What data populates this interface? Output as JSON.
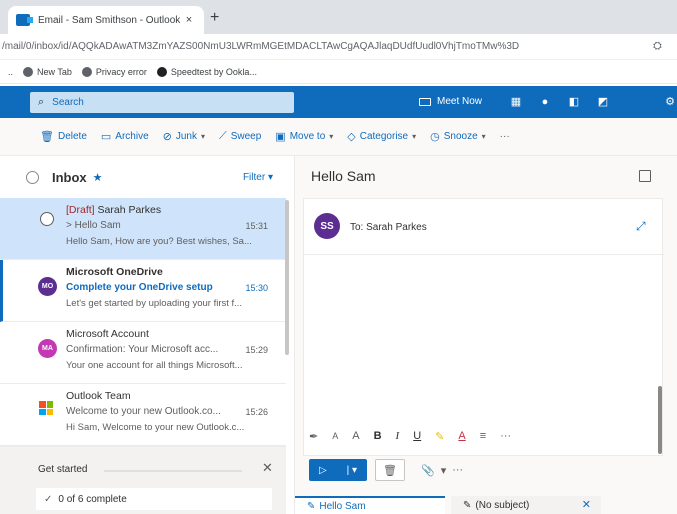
{
  "browser": {
    "tab_title": "Email - Sam Smithson - Outlook",
    "tab_close": "×",
    "new_tab": "+",
    "url": "/mail/0/inbox/id/AQQkADAwATM3ZmYAZS00NmU3LWRmMGEtMDACLTAwCgAQAJlaqDUdfUudl0VhjTmoTMw%3D",
    "bookmarks": [
      {
        "label": "New Tab",
        "icon": "globe-icon"
      },
      {
        "label": "Privacy error",
        "icon": "globe-icon"
      },
      {
        "label": "Speedtest by Ookla...",
        "icon": "speedtest-icon"
      }
    ]
  },
  "header": {
    "search_placeholder": "Search",
    "meet_now": "Meet Now",
    "brand_color": "#0f6cbd"
  },
  "commands": [
    {
      "label": "Delete",
      "icon": "trash-icon"
    },
    {
      "label": "Archive",
      "icon": "archive-icon"
    },
    {
      "label": "Junk",
      "icon": "block-icon"
    },
    {
      "label": "Sweep",
      "icon": "broom-icon"
    },
    {
      "label": "Move to",
      "icon": "folder-move-icon"
    },
    {
      "label": "Categorise",
      "icon": "tag-icon"
    },
    {
      "label": "Snooze",
      "icon": "clock-icon"
    },
    {
      "label": "···",
      "icon": "more-icon"
    }
  ],
  "inbox": {
    "title": "Inbox",
    "filter": "Filter",
    "messages": [
      {
        "draft_tag": "[Draft]",
        "sender": "Sarah Parkes",
        "subject": "> Hello Sam",
        "time": "15:31",
        "preview": "Hello Sam, How are you? Best wishes, Sa..."
      },
      {
        "initials": "MO",
        "sender": "Microsoft OneDrive",
        "subject": "Complete your OneDrive setup",
        "time": "15:30",
        "preview": "Let's get started by uploading your first f..."
      },
      {
        "initials": "MA",
        "sender": "Microsoft Account",
        "subject": "Confirmation: Your Microsoft acc...",
        "time": "15:29",
        "preview": "Your one account for all things Microsoft..."
      },
      {
        "sender": "Outlook Team",
        "subject": "Welcome to your new Outlook.co...",
        "time": "15:26",
        "preview": "Hi Sam, Welcome to your new Outlook.c..."
      }
    ]
  },
  "get_started": {
    "title": "Get started",
    "progress_text": "0 of 6 complete",
    "progress_fraction": 0
  },
  "reading": {
    "title": "Hello Sam",
    "avatar_initials": "SS",
    "to": "To: Sarah Parkes"
  },
  "format_bar": {
    "font_size_a": "A",
    "superscript": "A",
    "bold": "B",
    "italic": "I",
    "underline": "U",
    "highlight": "✎",
    "font_color": "A",
    "more": "···"
  },
  "draft_tabs": [
    {
      "label": "Hello Sam"
    },
    {
      "label": "(No subject)"
    }
  ]
}
